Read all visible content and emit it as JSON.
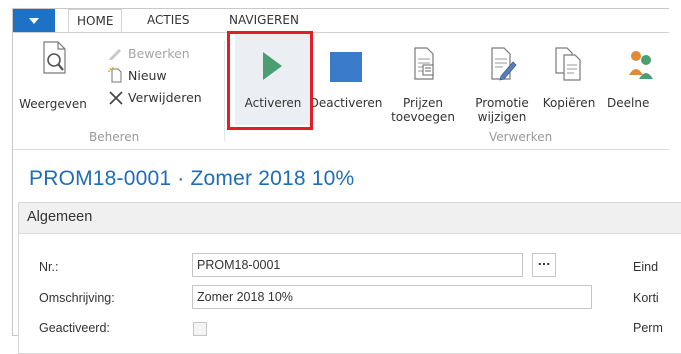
{
  "tabs": {
    "home": "HOME",
    "acties": "ACTIES",
    "navigeren": "NAVIGEREN"
  },
  "ribbon": {
    "beheren": {
      "group_label": "Beheren",
      "weergeven": "Weergeven",
      "bewerken": "Bewerken",
      "nieuw": "Nieuw",
      "verwijderen": "Verwijderen"
    },
    "verwerken": {
      "group_label": "Verwerken",
      "activeren": "Activeren",
      "deactiveren": "Deactiveren",
      "prijzen_line1": "Prijzen",
      "prijzen_line2": "toevoegen",
      "promotie_line1": "Promotie",
      "promotie_line2": "wijzigen",
      "kopieren": "Kopiëren",
      "deelnemers": "Deelne"
    }
  },
  "page": {
    "title": "PROM18-0001 · Zomer 2018 10%"
  },
  "general": {
    "header": "Algemeen",
    "nr_label": "Nr.:",
    "nr_value": "PROM18-0001",
    "lookup": "...",
    "omschrijving_label": "Omschrijving:",
    "omschrijving_value": "Zomer 2018 10%",
    "geactiveerd_label": "Geactiveerd:",
    "right_labels": [
      "Eind",
      "Korti",
      "Perm"
    ]
  },
  "colors": {
    "accent": "#1e72c6",
    "title": "#1f6db7",
    "play_green": "#4a9e72",
    "stop_blue": "#3a7cc9",
    "highlight": "#e31e26"
  }
}
